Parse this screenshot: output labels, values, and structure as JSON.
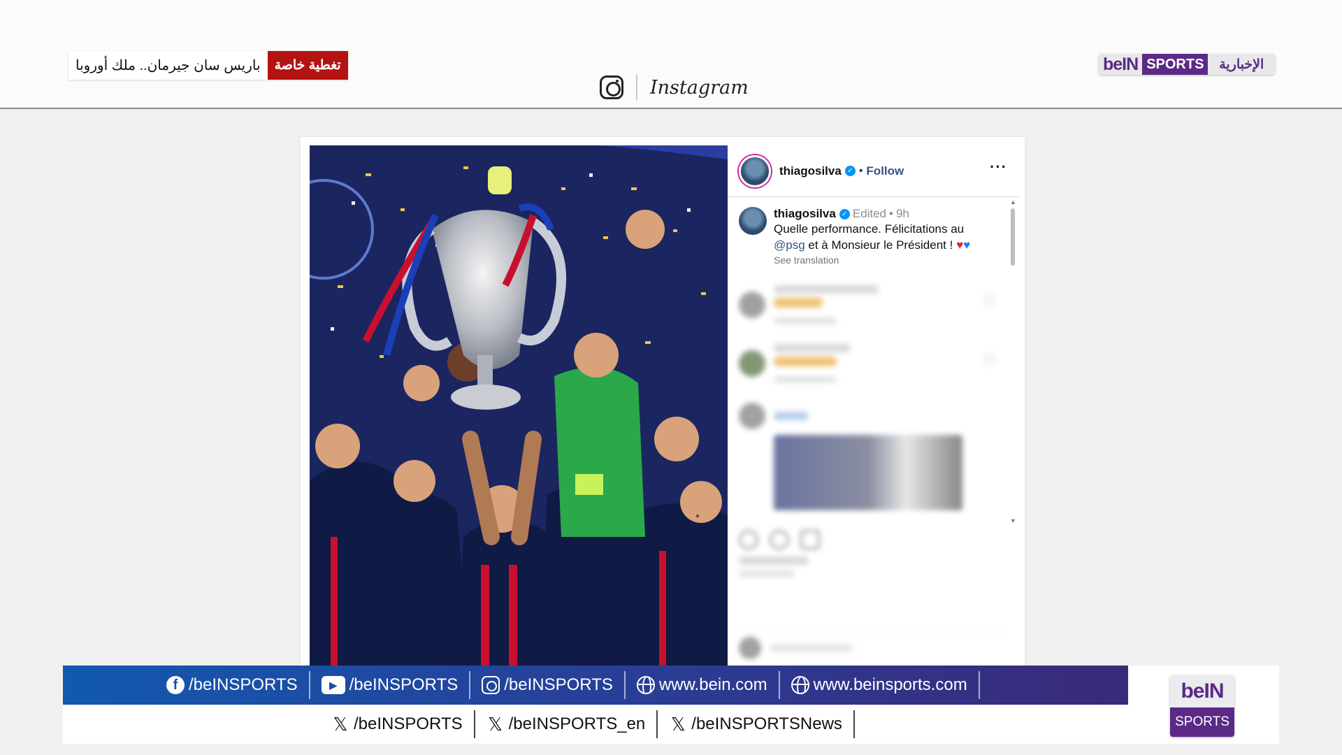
{
  "header": {
    "breaking_tag": "تغطية خاصة",
    "breaking_headline": "باريس سان جيرمان.. ملك أوروبا",
    "platform_name": "Instagram",
    "channel_logo": {
      "b": "beIN",
      "s": "SPORTS",
      "a": "الإخبارية"
    }
  },
  "post": {
    "username": "thiagosilva",
    "follow_label": "Follow",
    "more_label": "···",
    "caption": {
      "username": "thiagosilva",
      "edited": "Edited",
      "time": "9h",
      "text_1": "Quelle performance. Félicitations au",
      "mention": "@psg",
      "text_2": " et à Monsieur le Président ! ",
      "heart_red": "♥",
      "heart_blue": "♥",
      "see_translation": "See translation"
    }
  },
  "social_bar": {
    "top": [
      {
        "icon": "facebook-icon",
        "glyph": "f",
        "label": "/beINSPORTS"
      },
      {
        "icon": "youtube-icon",
        "glyph": "▶",
        "label": "/beINSPORTS"
      },
      {
        "icon": "instagram-icon",
        "glyph": "",
        "label": "/beINSPORTS"
      },
      {
        "icon": "globe-icon",
        "glyph": "",
        "label": "www.bein.com"
      },
      {
        "icon": "globe-icon",
        "glyph": "",
        "label": "www.beinsports.com"
      }
    ],
    "bottom": [
      {
        "icon": "x-icon",
        "glyph": "𝕏",
        "label": "/beINSPORTS"
      },
      {
        "icon": "x-icon",
        "glyph": "𝕏",
        "label": "/beINSPORTS_en"
      },
      {
        "icon": "x-icon",
        "glyph": "𝕏",
        "label": "/beINSPORTSNews"
      }
    ]
  },
  "corner_logo": {
    "b": "beIN",
    "s": "SPORTS"
  },
  "colors": {
    "breaking_red": "#b51212",
    "bein_purple": "#5b2a86",
    "bar_blue": "#1259b0",
    "instagram_link": "#385185"
  }
}
